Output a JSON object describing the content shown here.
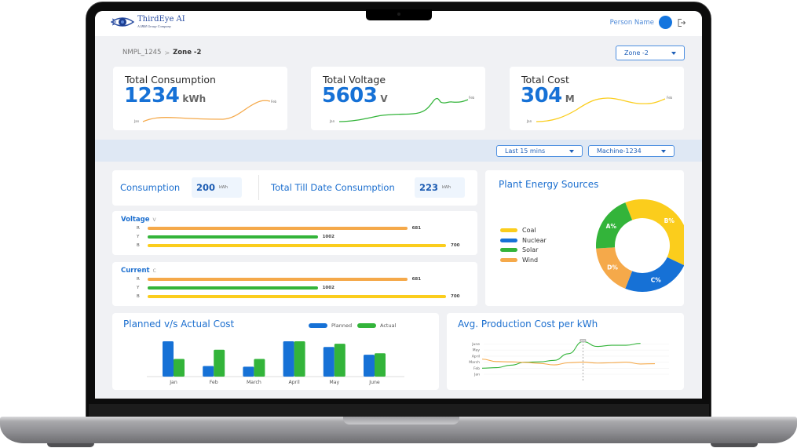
{
  "app": {
    "logo_name": "ThirdEye AI",
    "logo_subtitle": "A IBM Group Company",
    "user_name": "Person Name",
    "icons": {
      "logo": "eye-logo-icon",
      "avatar": "avatar-circle",
      "logout": "logout-icon"
    }
  },
  "breadcrumb": {
    "parent": "NMPL_1245",
    "separator": ">",
    "current": "Zone -2"
  },
  "filters": {
    "zone": "Zone -2",
    "time_range": "Last 15 mins",
    "machine": "Machine-1234"
  },
  "kpis": [
    {
      "title": "Total Consumption",
      "value": "1234",
      "unit": "kWh",
      "start_label": "Jan",
      "end_label": "Feb",
      "color": "#f5a94a"
    },
    {
      "title": "Total Voltage",
      "value": "5603",
      "unit": "V",
      "start_label": "Jan",
      "end_label": "Feb",
      "color": "#33b43a"
    },
    {
      "title": "Total Cost",
      "value": "304",
      "unit": "M",
      "start_label": "Jan",
      "end_label": "Feb",
      "color": "#fbcd1c"
    }
  ],
  "consumption": {
    "label": "Consumption",
    "value": "200",
    "unit": "kWh",
    "till_date_label": "Total Till Date Consumption",
    "till_date_value": "223",
    "till_date_unit": "kWh"
  },
  "voltage": {
    "title": "Voltage",
    "unit": "V",
    "rows": [
      {
        "phase": "R",
        "value": "681",
        "fill": 0.87,
        "color": "#f5a94a"
      },
      {
        "phase": "Y",
        "value": "1002",
        "fill": 0.57,
        "color": "#33b43a"
      },
      {
        "phase": "B",
        "value": "700",
        "fill": 1.0,
        "color": "#fbcd1c"
      }
    ]
  },
  "current": {
    "title": "Current",
    "unit": "C",
    "rows": [
      {
        "phase": "R",
        "value": "681",
        "fill": 0.87,
        "color": "#f5a94a"
      },
      {
        "phase": "Y",
        "value": "1002",
        "fill": 0.57,
        "color": "#33b43a"
      },
      {
        "phase": "B",
        "value": "700",
        "fill": 1.0,
        "color": "#fbcd1c"
      }
    ]
  },
  "chart_data": [
    {
      "type": "pie",
      "title": "Plant Energy Sources",
      "donut": true,
      "legend": "left",
      "series": [
        {
          "name": "Coal",
          "label": "B%",
          "value": 38,
          "color": "#fbcd1c"
        },
        {
          "name": "Nuclear",
          "label": "C%",
          "value": 24,
          "color": "#1671d6"
        },
        {
          "name": "Wind",
          "label": "D%",
          "value": 18,
          "color": "#f5a94a"
        },
        {
          "name": "Solar",
          "label": "A%",
          "value": 20,
          "color": "#33b43a"
        }
      ],
      "legend_order": [
        "Coal",
        "Nuclear",
        "Solar",
        "Wind"
      ]
    },
    {
      "type": "bar",
      "title": "Planned v/s Actual Cost",
      "categories": [
        "Jan",
        "Feb",
        "March",
        "April",
        "May",
        "June"
      ],
      "series": [
        {
          "name": "Planned",
          "values": [
            100,
            30,
            28,
            100,
            84,
            62
          ],
          "color": "#1671d6"
        },
        {
          "name": "Actual",
          "values": [
            50,
            76,
            50,
            100,
            93,
            66
          ],
          "color": "#33b43a"
        }
      ],
      "ylim": [
        0,
        100
      ],
      "legend": "top-right",
      "xlabel": "",
      "ylabel": ""
    },
    {
      "type": "line",
      "title": "Avg. Production Cost per kWh",
      "yticks": [
        "Jan",
        "Feb",
        "March",
        "April",
        "May",
        "June"
      ],
      "x": [
        0,
        1,
        2,
        3,
        4,
        5,
        6,
        7,
        8,
        9,
        10,
        11,
        12
      ],
      "series": [
        {
          "name": "green",
          "color": "#33b43a",
          "values": [
            1.0,
            1.1,
            1.5,
            2.0,
            2.05,
            2.3,
            3.4,
            5.4,
            4.6,
            4.8,
            4.8,
            5.1,
            null
          ]
        },
        {
          "name": "orange",
          "color": "#f5a94a",
          "values": [
            2.5,
            2.1,
            2.05,
            1.95,
            1.8,
            1.55,
            1.9,
            2.0,
            1.85,
            1.9,
            2.0,
            1.7,
            1.75
          ]
        }
      ],
      "marker_x": 7,
      "marker_label": "100",
      "grid": true
    }
  ]
}
